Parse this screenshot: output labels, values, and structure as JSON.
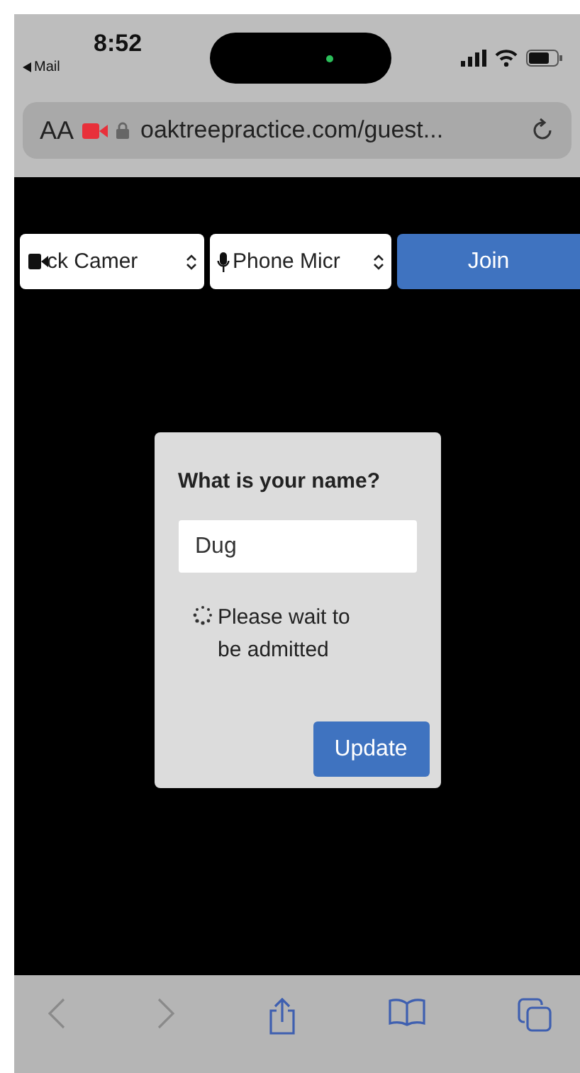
{
  "status_bar": {
    "back_app": "Mail",
    "time": "8:52"
  },
  "address_bar": {
    "text_size": "AA",
    "url": "oaktreepractice.com/guest..."
  },
  "device_bar": {
    "camera_select": "ck Camer",
    "microphone_select": "Phone Micr",
    "join_button": "Join"
  },
  "dialog": {
    "title": "What is your name?",
    "name_field": "Dug",
    "status": "Please wait to be admitted",
    "button": "Update"
  },
  "bottom_toolbar": [
    {
      "kind": "back",
      "disabled": true
    },
    {
      "kind": "forward",
      "disabled": true
    },
    {
      "kind": "share",
      "disabled": false
    },
    {
      "kind": "bookmarks",
      "disabled": false
    },
    {
      "kind": "tabs",
      "disabled": false
    }
  ]
}
